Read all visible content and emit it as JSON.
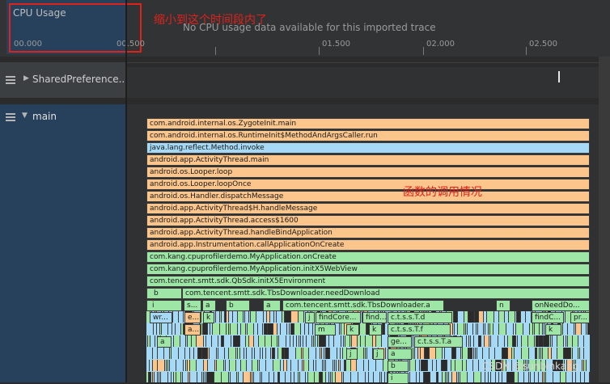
{
  "cpu": {
    "label": "CPU Usage",
    "no_data_text": "No CPU usage data available for this imported trace",
    "annotation": "缩小到这个时间段内了",
    "ticks": [
      "00.000",
      "00.500",
      "01.500",
      "02.000",
      "02.500"
    ]
  },
  "threads": {
    "shared_prefs": "SharedPreference...",
    "main": "main"
  },
  "annotation_mid": "函数的调用情况",
  "watermark": "CSDN @sunbinkang",
  "stack": [
    {
      "label": "com.android.internal.os.ZygoteInit.main",
      "kind": "o"
    },
    {
      "label": "com.android.internal.os.RuntimeInit$MethodAndArgsCaller.run",
      "kind": "o"
    },
    {
      "label": "java.lang.reflect.Method.invoke",
      "kind": "b"
    },
    {
      "label": "android.app.ActivityThread.main",
      "kind": "o"
    },
    {
      "label": "android.os.Looper.loop",
      "kind": "o"
    },
    {
      "label": "android.os.Looper.loopOnce",
      "kind": "o"
    },
    {
      "label": "android.os.Handler.dispatchMessage",
      "kind": "o"
    },
    {
      "label": "android.app.ActivityThread$H.handleMessage",
      "kind": "o"
    },
    {
      "label": "android.app.ActivityThread.access$1600",
      "kind": "o"
    },
    {
      "label": "android.app.ActivityThread.handleBindApplication",
      "kind": "o"
    },
    {
      "label": "android.app.Instrumentation.callApplicationOnCreate",
      "kind": "o"
    },
    {
      "label": "com.kang.cpuprofilerdemo.MyApplication.onCreate",
      "kind": "g"
    },
    {
      "label": "com.kang.cpuprofilerdemo.MyApplication.initX5WebView",
      "kind": "g"
    },
    {
      "label": "com.tencent.smtt.sdk.QbSdk.initX5Environment",
      "kind": "g"
    }
  ],
  "row15": [
    {
      "label": "b",
      "kind": "g"
    },
    {
      "label": "com.tencent.smtt.sdk.TbsDownloader.needDownload",
      "kind": "g"
    }
  ],
  "row16": [
    {
      "label": "i",
      "kind": "g"
    },
    {
      "label": "s...",
      "kind": "g"
    },
    {
      "label": "a",
      "kind": "g"
    },
    {
      "label": "b",
      "kind": "g"
    },
    {
      "label": "a",
      "kind": "g"
    },
    {
      "label": "com.tencent.smtt.sdk.TbsDownloader.a",
      "kind": "g"
    },
    {
      "label": "n",
      "kind": "g"
    },
    {
      "label": "onNeedDo...",
      "kind": "g"
    }
  ],
  "row17": [
    {
      "label": "wr...",
      "kind": "b"
    },
    {
      "label": "e...",
      "kind": "o"
    },
    {
      "label": "k",
      "kind": "g"
    },
    {
      "label": "j",
      "kind": "g"
    },
    {
      "label": "findCore...",
      "kind": "g"
    },
    {
      "label": "find...",
      "kind": "g"
    },
    {
      "label": "c.t.s.s.T.d",
      "kind": "g"
    },
    {
      "label": "findC...",
      "kind": "g"
    },
    {
      "label": "pr...",
      "kind": "g"
    }
  ],
  "row18": [
    {
      "label": "a...",
      "kind": "o"
    },
    {
      "label": "m",
      "kind": "g"
    },
    {
      "label": "k",
      "kind": "g"
    },
    {
      "label": "k",
      "kind": "g"
    },
    {
      "label": "c.t.s.s.T.f",
      "kind": "g"
    },
    {
      "label": "k",
      "kind": "g"
    }
  ],
  "row19": [
    {
      "label": "a",
      "kind": "g"
    },
    {
      "label": "ge...",
      "kind": "g"
    },
    {
      "label": "c.t.s.s.T.a",
      "kind": "g"
    }
  ],
  "row20": [
    {
      "label": "j",
      "kind": "g"
    },
    {
      "label": "j",
      "kind": "g"
    },
    {
      "label": "a",
      "kind": "g"
    }
  ],
  "row21": [
    {
      "label": "b",
      "kind": "g"
    }
  ],
  "row22": [
    {
      "label": "i",
      "kind": "g"
    }
  ]
}
